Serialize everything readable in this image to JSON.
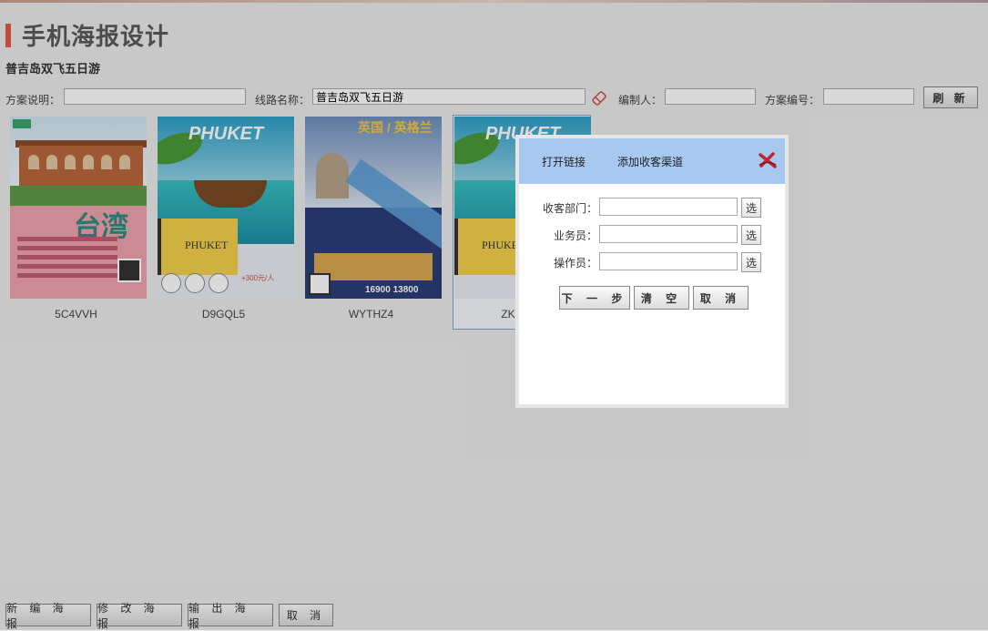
{
  "page": {
    "title": "手机海报设计",
    "subtitle": "普吉岛双飞五日游"
  },
  "filters": {
    "plan_desc_label": "方案说明：",
    "plan_desc_value": "",
    "route_name_label": "线路名称：",
    "route_name_value": "普吉岛双飞五日游",
    "editor_label": "编制人：",
    "editor_value": "",
    "plan_no_label": "方案编号：",
    "plan_no_value": "",
    "refresh_label": "刷 新"
  },
  "posters": [
    {
      "code": "5C4VVH",
      "theme": "taiwan",
      "big_text": "台湾"
    },
    {
      "code": "D9GQL5",
      "theme": "phuket",
      "head_text": "PHUKET",
      "name_text": "PHUKET",
      "price_text": "+300元/人"
    },
    {
      "code": "WYTHZ4",
      "theme": "uk",
      "head_text": "英国 / 英格兰",
      "price_text": "16900  13800"
    },
    {
      "code": "ZK",
      "theme": "phuket",
      "head_text": "PHUKET",
      "name_text": "PHUKET"
    }
  ],
  "bottom_buttons": {
    "new_poster": "新 编 海 报",
    "edit_poster": "修 改 海 报",
    "export_poster": "输 出 海 报",
    "cancel": "取 消"
  },
  "dialog": {
    "tab_open_link": "打开链接",
    "tab_add_channel": "添加收客渠道",
    "fields": {
      "dept_label": "收客部门：",
      "sales_label": "业务员：",
      "operator_label": "操作员：",
      "pick_label": "选"
    },
    "buttons": {
      "next": "下 一 步",
      "clear": "清 空",
      "cancel": "取 消"
    }
  },
  "colors": {
    "accent": "#e25c4a",
    "dialog_header": "#a7c9ef",
    "selected_border": "#7ea6c9"
  }
}
